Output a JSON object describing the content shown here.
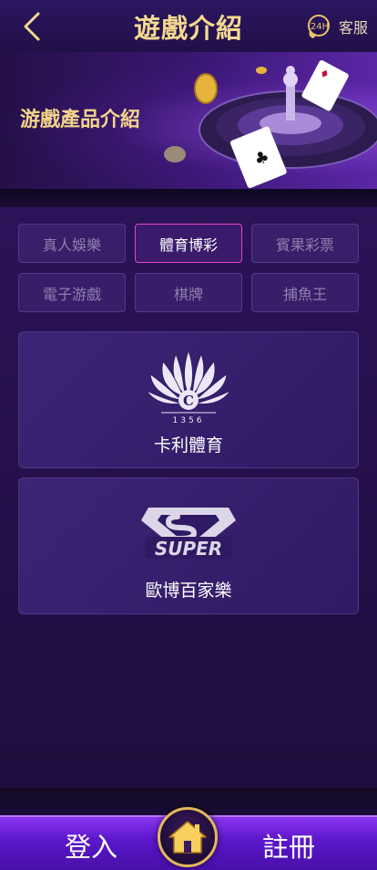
{
  "header": {
    "title": "遊戲介紹",
    "service_label": "客服",
    "service_badge": "24H"
  },
  "banner": {
    "title": "游戲產品介紹"
  },
  "tabs": [
    {
      "label": "真人娛樂",
      "active": false
    },
    {
      "label": "體育博彩",
      "active": true
    },
    {
      "label": "賓果彩票",
      "active": false
    },
    {
      "label": "電子游戲",
      "active": false
    },
    {
      "label": "棋牌",
      "active": false
    },
    {
      "label": "捕魚王",
      "active": false
    }
  ],
  "cards": [
    {
      "label": "卡利體育",
      "logo_icon": "cali-peacock-logo-icon",
      "logo_text": "C",
      "logo_number": "1356"
    },
    {
      "label": "歐博百家樂",
      "logo_icon": "super-logo-icon",
      "logo_text": "SUPER"
    }
  ],
  "bottom_nav": {
    "login_label": "登入",
    "register_label": "註冊",
    "home_icon": "home-icon"
  },
  "colors": {
    "accent_gold": "#f4d98f",
    "active_tab_border": "#e245c3",
    "bottom_bar": "#6a1fe0"
  }
}
